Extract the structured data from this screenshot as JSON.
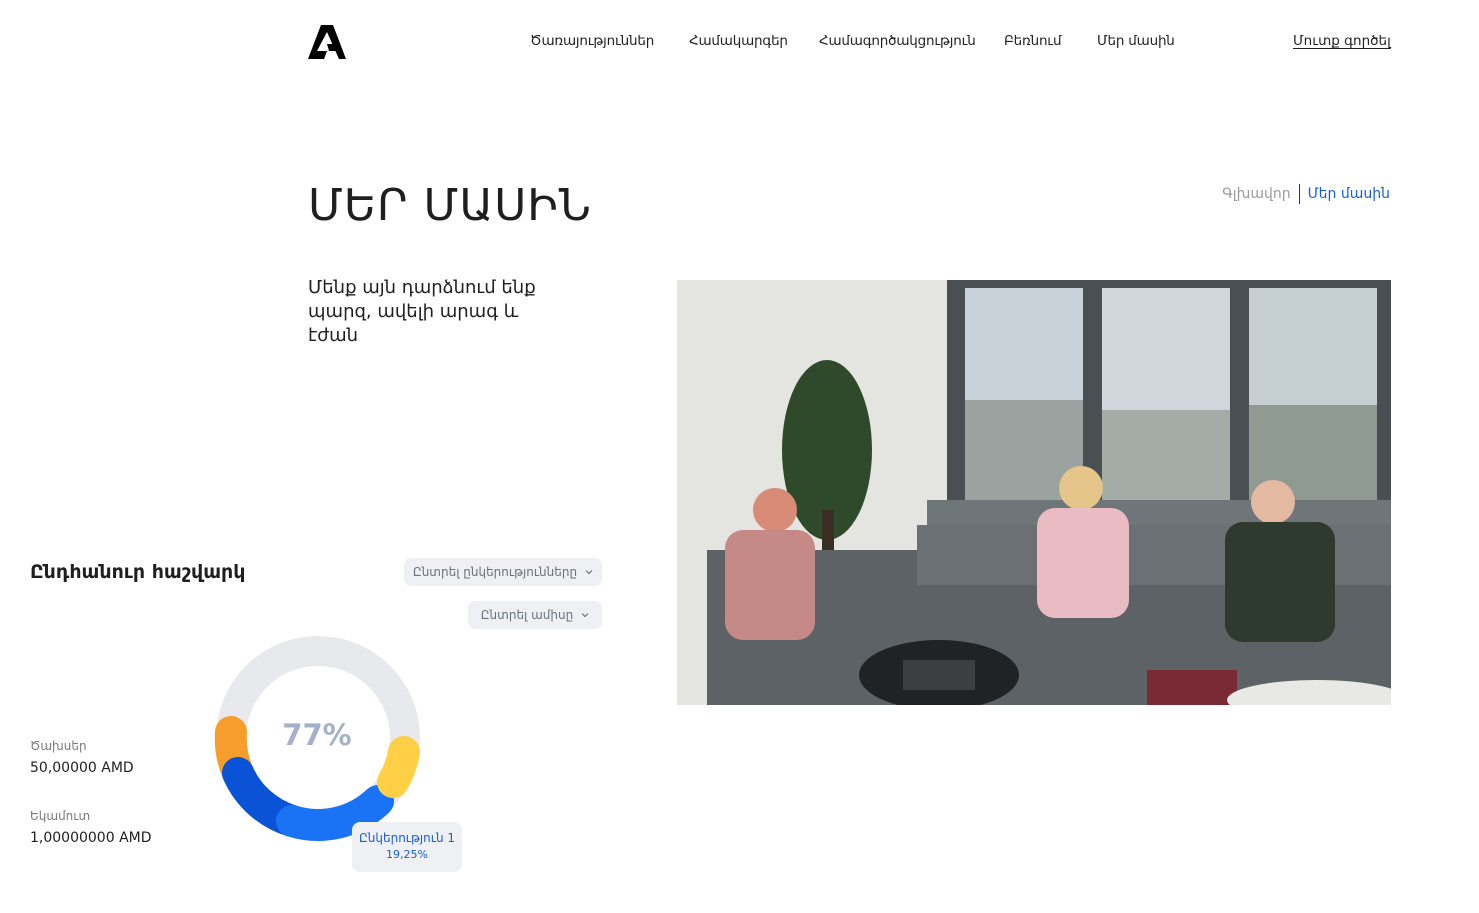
{
  "header": {
    "logo_icon": "brand-logo-icon",
    "nav": [
      {
        "label": "Ծառայություններ"
      },
      {
        "label": "Համակարգեր"
      },
      {
        "label": "Համագործակցություն"
      },
      {
        "label": "Բեռնում"
      },
      {
        "label": "Մեր մասին"
      }
    ],
    "login_label": "Մուտք գործել"
  },
  "page": {
    "title": "ՄԵՐ ՄԱՍԻՆ",
    "breadcrumb": {
      "home": "Գլխավոր",
      "current": "Մեր մասին"
    },
    "intro": "Մենք այն դարձնում ենք պարզ, ավելի արագ և էժան"
  },
  "calculator": {
    "title": "Ընդհանուր հաշվարկ",
    "select_services": "Ընտրել ընկերությունները",
    "select_month": "Ընտրել ամիսը",
    "chevron_icon": "chevron-down-icon",
    "expenses_label": "Ծախսեր",
    "expenses_value": "50,00000 AMD",
    "income_label": "Եկամուտ",
    "income_value": "1,00000000 AMD",
    "percent_label": "77%",
    "tooltip": {
      "label": "Ընկերություն 1",
      "value": "19,25%"
    }
  },
  "colors": {
    "accent_blue": "#1a5fd0",
    "ring_track": "#e8e9ec",
    "seg_orange": "#f59e2b",
    "seg_dark_blue": "#0a53d6",
    "seg_blue": "#1a73f5",
    "seg_yellow": "#ffcf45"
  }
}
